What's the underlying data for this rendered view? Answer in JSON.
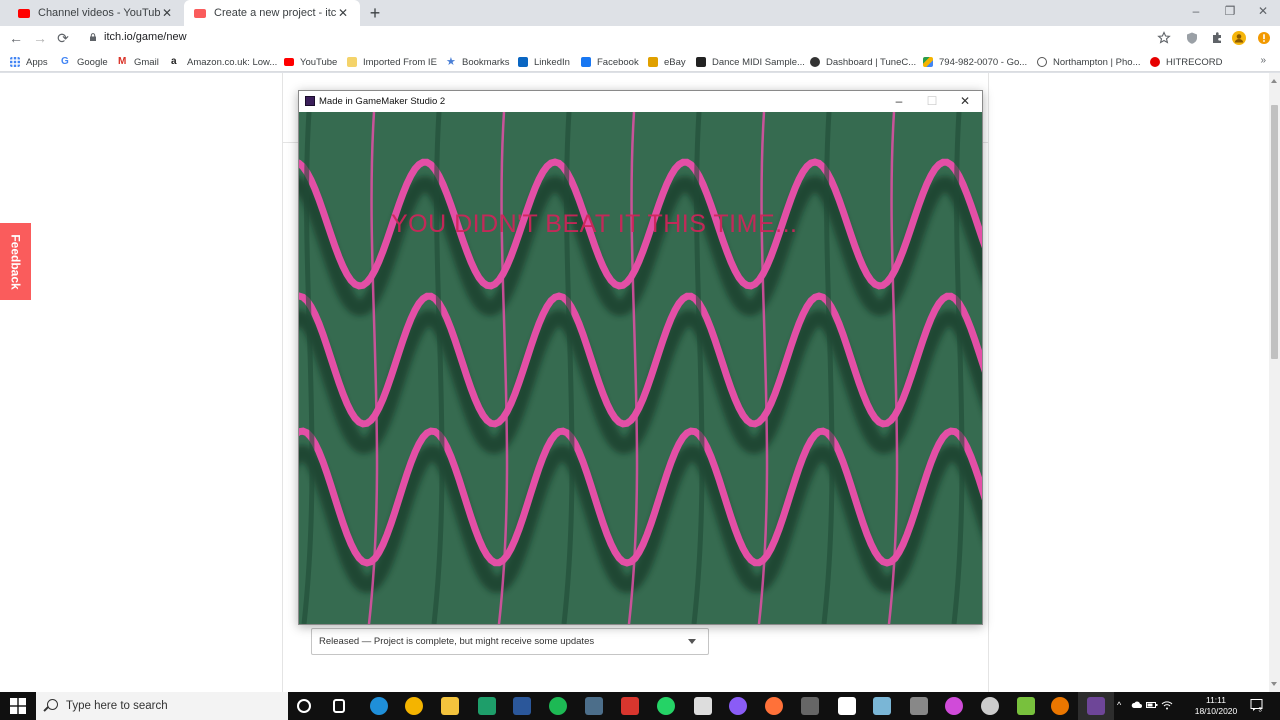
{
  "browser": {
    "tabs": [
      {
        "title": "Channel videos - YouTube Studio",
        "favicon_color": "#ff0000"
      },
      {
        "title": "Create a new project - itch.io",
        "favicon_color": "#fa5c5c"
      }
    ],
    "new_tab_symbol": "+",
    "close_symbol": "✕",
    "window_controls": {
      "minimize": "–",
      "restore": "❐",
      "close": "✕"
    },
    "url": "itch.io/game/new",
    "nav": {
      "back": "←",
      "forward": "→",
      "reload": "⟳"
    },
    "bookmarks": [
      {
        "label": "Apps",
        "icon": "apps-grid-icon",
        "color": "#4285f4"
      },
      {
        "label": "Google",
        "icon": "google-icon",
        "color": "#4285f4"
      },
      {
        "label": "Gmail",
        "icon": "gmail-icon",
        "color": "#d93025"
      },
      {
        "label": "Amazon.co.uk: Low...",
        "icon": "amazon-icon",
        "color": "#222222"
      },
      {
        "label": "YouTube",
        "icon": "youtube-icon",
        "color": "#ff0000"
      },
      {
        "label": "Imported From IE",
        "icon": "folder-icon",
        "color": "#f4d36a"
      },
      {
        "label": "Bookmarks",
        "icon": "star-icon",
        "color": "#4a7fd6"
      },
      {
        "label": "LinkedIn",
        "icon": "linkedin-icon",
        "color": "#0a66c2"
      },
      {
        "label": "Facebook",
        "icon": "facebook-icon",
        "color": "#1877f2"
      },
      {
        "label": "eBay",
        "icon": "bag-icon",
        "color": "#e0a000"
      },
      {
        "label": "Dance MIDI Sample...",
        "icon": "dms-icon",
        "color": "#222222"
      },
      {
        "label": "Dashboard | TuneC...",
        "icon": "tunecore-icon",
        "color": "#333333"
      },
      {
        "label": "794-982-0070 - Go...",
        "icon": "google-drive-icon",
        "color": "#2a9d4b"
      },
      {
        "label": "Northampton | Pho...",
        "icon": "globe-icon",
        "color": "#555555"
      },
      {
        "label": "HITRECORD",
        "icon": "hitrecord-icon",
        "color": "#e60000"
      }
    ],
    "bookmarks_more": "»"
  },
  "page": {
    "feedback_label": "Feedback",
    "release_status": "Released — Project is complete, but might receive some updates"
  },
  "game_window": {
    "title": "Made in GameMaker Studio 2",
    "message": "YOU DIDN'T BEAT IT THIS TIME...",
    "background_color": "#366b50",
    "wave_color": "#e34fa6",
    "message_color": "#d0245a",
    "controls": {
      "minimize": "–",
      "maximize": "☐",
      "close": "✕"
    }
  },
  "taskbar": {
    "search_placeholder": "Type here to search",
    "apps": [
      {
        "icon": "cortana-icon",
        "color": "#ffffff"
      },
      {
        "icon": "task-view-icon",
        "color": "#ffffff"
      },
      {
        "icon": "edge-icon",
        "color": "#1f8fd9"
      },
      {
        "icon": "chrome-icon",
        "color": "#f4b400"
      },
      {
        "icon": "file-explorer-icon",
        "color": "#f3c33d"
      },
      {
        "icon": "game-app-icon",
        "color": "#1e9e6a"
      },
      {
        "icon": "word-icon",
        "color": "#2b579a"
      },
      {
        "icon": "spotify-icon",
        "color": "#1db954"
      },
      {
        "icon": "krita-icon",
        "color": "#4c6e8a"
      },
      {
        "icon": "acrobat-icon",
        "color": "#d8362e"
      },
      {
        "icon": "whatsapp-icon",
        "color": "#25d366"
      },
      {
        "icon": "inkscape-icon",
        "color": "#dddddd"
      },
      {
        "icon": "podcast-icon",
        "color": "#8a5cf6"
      },
      {
        "icon": "firefox-icon",
        "color": "#ff7139"
      },
      {
        "icon": "live-app-icon",
        "color": "#666666"
      },
      {
        "icon": "gamemaker-icon",
        "color": "#ffffff"
      },
      {
        "icon": "notes-icon",
        "color": "#7ab6d6"
      },
      {
        "icon": "misc-app-icon",
        "color": "#888888"
      },
      {
        "icon": "media-app-icon",
        "color": "#d04bd9"
      },
      {
        "icon": "obs-icon",
        "color": "#cccccc"
      },
      {
        "icon": "utorrent-icon",
        "color": "#78c13d"
      },
      {
        "icon": "blender-icon",
        "color": "#ea7600"
      },
      {
        "icon": "running-game-icon",
        "color": "#5a2d8a"
      }
    ],
    "time": "11:11",
    "date": "18/10/2020",
    "notification_count": "3",
    "tray_symbol": "^"
  }
}
